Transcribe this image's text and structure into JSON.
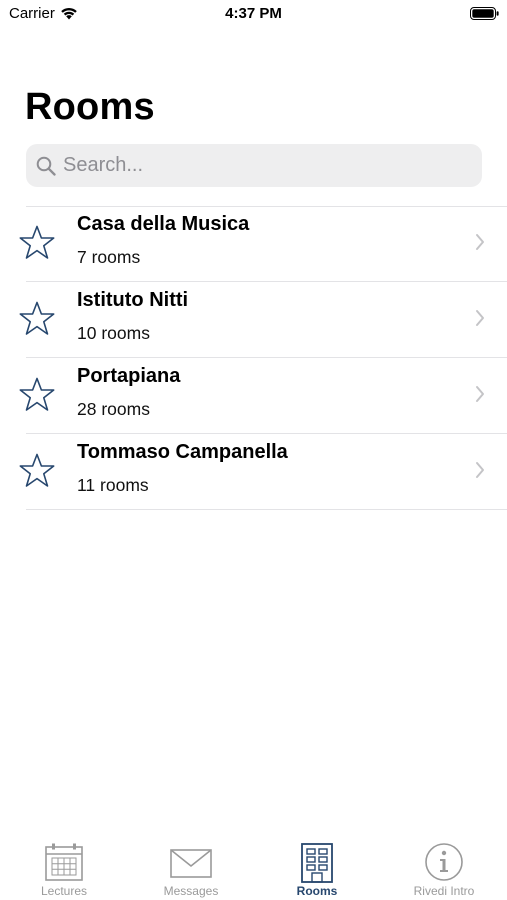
{
  "status_bar": {
    "carrier": "Carrier",
    "time": "4:37 PM"
  },
  "page": {
    "title": "Rooms"
  },
  "search": {
    "placeholder": "Search..."
  },
  "rooms": [
    {
      "name": "Casa della Musica",
      "count": "7 rooms"
    },
    {
      "name": "Istituto Nitti",
      "count": "10 rooms"
    },
    {
      "name": "Portapiana",
      "count": "28 rooms"
    },
    {
      "name": "Tommaso Campanella",
      "count": "11 rooms"
    }
  ],
  "tabs": [
    {
      "label": "Lectures",
      "icon": "calendar-icon",
      "active": false
    },
    {
      "label": "Messages",
      "icon": "envelope-icon",
      "active": false
    },
    {
      "label": "Rooms",
      "icon": "building-icon",
      "active": true
    },
    {
      "label": "Rivedi Intro",
      "icon": "info-icon",
      "active": false
    }
  ],
  "colors": {
    "accent": "#27476e",
    "inactive": "#9a9a9a",
    "separator": "#e3e3e6",
    "search_bg": "#eeeeef"
  }
}
